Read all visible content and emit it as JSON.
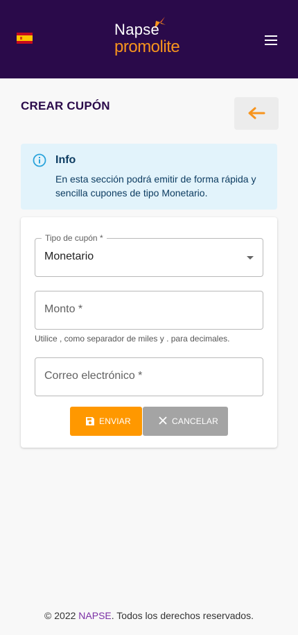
{
  "header": {
    "language_flag": "spain-flag-icon",
    "logo": {
      "top": "Napse",
      "bottom": "promolite"
    },
    "menu_icon": "hamburger-menu-icon"
  },
  "page": {
    "title": "CREAR CUPÓN",
    "back_icon": "arrow-left-icon"
  },
  "info": {
    "title": "Info",
    "text": "En esta sección podrá emitir de forma rápida y sencilla cupones de tipo Monetario."
  },
  "form": {
    "coupon_type": {
      "label": "Tipo de cupón *",
      "value": "Monetario"
    },
    "amount": {
      "placeholder": "Monto *",
      "helper": "Utilice , como separador de miles y . para decimales."
    },
    "email": {
      "placeholder": "Correo electrónico *"
    },
    "send_label": "ENVIAR",
    "cancel_label": "CANCELAR"
  },
  "footer": {
    "prefix": "© 2022 ",
    "link": "NAPSE",
    "suffix": ". Todos los derechos reservados."
  },
  "colors": {
    "header_bg": "#2a0a4a",
    "accent_orange": "#ff9800",
    "info_bg": "#e2f3fb",
    "link_purple": "#7b2fa5"
  }
}
